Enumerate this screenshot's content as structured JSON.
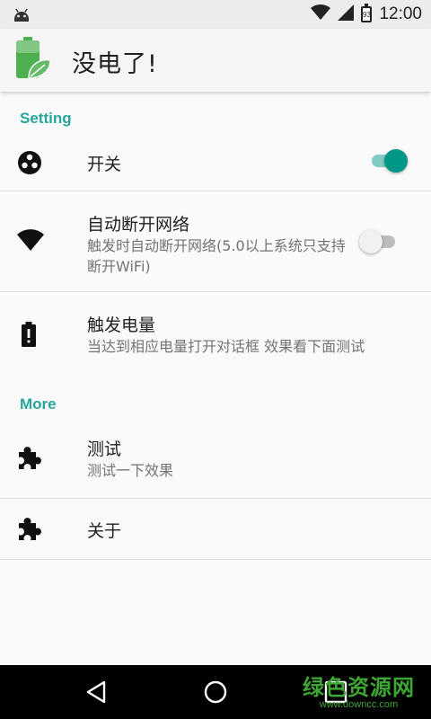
{
  "status_bar": {
    "time": "12:00",
    "battery_level": "93",
    "icons": [
      "android-debug-icon",
      "wifi-icon",
      "signal-icon",
      "battery-icon"
    ]
  },
  "app_bar": {
    "title": "没电了!",
    "logo_icon": "battery-leaf-icon"
  },
  "sections": [
    {
      "header": "Setting",
      "items": [
        {
          "title": "开关",
          "summary": "",
          "icon": "toggle-circles-icon",
          "switch": true
        },
        {
          "title": "自动断开网络",
          "summary": "触发时自动断开网络(5.0以上系统只支持断开WiFi)",
          "icon": "wifi-icon",
          "switch": false
        },
        {
          "title": "触发电量",
          "summary": "当达到相应电量打开对话框 效果看下面测试",
          "icon": "battery-alert-icon"
        }
      ]
    },
    {
      "header": "More",
      "items": [
        {
          "title": "测试",
          "summary": "测试一下效果",
          "icon": "puzzle-icon"
        },
        {
          "title": "关于",
          "summary": "",
          "icon": "puzzle-icon"
        }
      ]
    }
  ],
  "nav_bar": {
    "buttons": [
      "back-icon",
      "home-icon",
      "recents-icon"
    ]
  },
  "watermark": {
    "main": "绿色资源网",
    "sub": "www.downcc.com"
  },
  "colors": {
    "accent": "#009688",
    "section_header": "#26a69a",
    "switch_on_track": "#80cbc4",
    "switch_off_track": "#bdbdbd",
    "switch_off_thumb": "#f1f1f1",
    "logo_green": "#4caf50"
  }
}
